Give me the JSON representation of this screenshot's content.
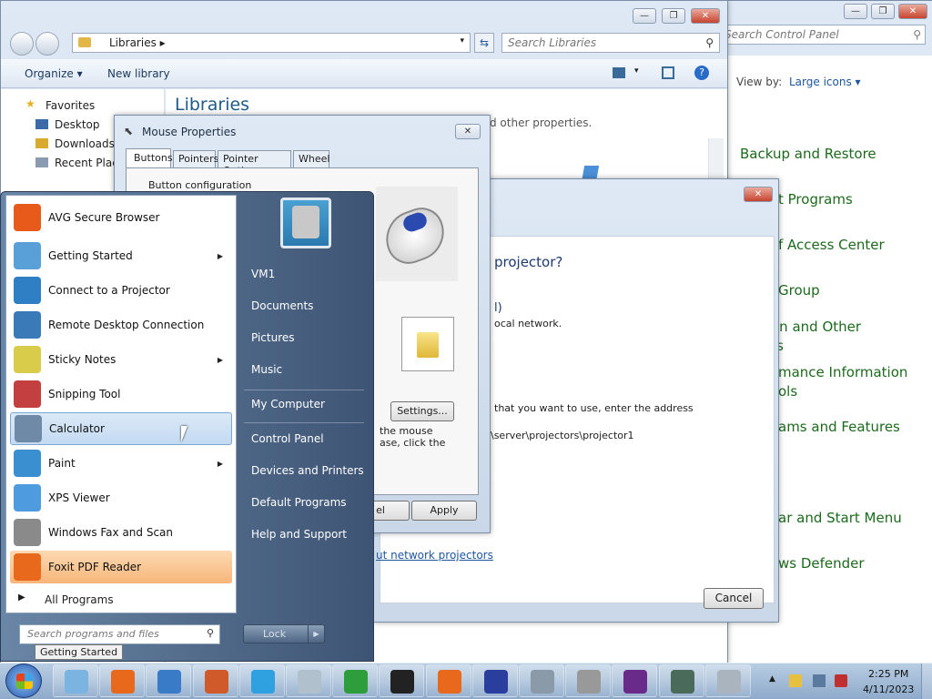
{
  "control_panel": {
    "search_placeholder": "Search Control Panel",
    "view_by_label": "View by:",
    "view_by_value": "Large icons",
    "items": [
      "Backup and Restore",
      "t Programs",
      "f Access Center",
      "Group",
      "on and Other",
      "rs",
      "mance Information",
      "ols",
      "ams and Features",
      "ar and Start Menu",
      "ws Defender"
    ]
  },
  "libraries": {
    "address": "Libraries",
    "search_placeholder": "Search Libraries",
    "organize": "Organize",
    "new_library": "New library",
    "title": "Libraries",
    "desc": "d other properties.",
    "nav": {
      "favorites": "Favorites",
      "desktop": "Desktop",
      "downloads": "Downloads",
      "recent": "Recent Place"
    }
  },
  "mouse": {
    "title": "Mouse Properties",
    "tabs": [
      "Buttons",
      "Pointers",
      "Pointer Options",
      "Wheel"
    ],
    "group": "Button configuration",
    "settings": "Settings...",
    "text1": "the mouse",
    "text2": "ase, click the",
    "cancel_partial": "el",
    "apply": "Apply"
  },
  "projector": {
    "question": "projector?",
    "line1": "l)",
    "line2": "ocal network.",
    "line3": "that you want to use, enter the address",
    "line4": "\\server\\projectors\\projector1",
    "link": "ut network projectors",
    "cancel": "Cancel"
  },
  "start_menu": {
    "items": [
      {
        "label": "AVG Secure Browser",
        "arrow": false,
        "color": "#e85a1a"
      },
      {
        "label": "Getting Started",
        "arrow": true,
        "color": "#5aa0d8"
      },
      {
        "label": "Connect to a Projector",
        "arrow": false,
        "color": "#2f7fc4"
      },
      {
        "label": "Remote Desktop Connection",
        "arrow": false,
        "color": "#3a7ab8"
      },
      {
        "label": "Sticky Notes",
        "arrow": true,
        "color": "#d8cc4a"
      },
      {
        "label": "Snipping Tool",
        "arrow": false,
        "color": "#c44040"
      },
      {
        "label": "Calculator",
        "arrow": false,
        "color": "#6f8aa6"
      },
      {
        "label": "Paint",
        "arrow": true,
        "color": "#3a8fd0"
      },
      {
        "label": "XPS Viewer",
        "arrow": false,
        "color": "#4e9be0"
      },
      {
        "label": "Windows Fax and Scan",
        "arrow": false,
        "color": "#8a8a8a"
      },
      {
        "label": "Foxit PDF Reader",
        "arrow": false,
        "color": "#e8691c"
      }
    ],
    "all_programs": "All Programs",
    "search_placeholder": "Search programs and files",
    "tooltip": "Getting Started",
    "right": [
      "VM1",
      "Documents",
      "Pictures",
      "Music",
      "My Computer",
      "Control Panel",
      "Devices and Printers",
      "Default Programs",
      "Help and Support"
    ],
    "lock": "Lock"
  },
  "taskbar": {
    "time": "2:25 PM",
    "date": "4/11/2023",
    "buttons": [
      "#7bb4e0",
      "#e8691c",
      "#3a7bc8",
      "#d05a2a",
      "#2fa0e0",
      "#b0c0cc",
      "#2e9e3c",
      "#222",
      "#e8691c",
      "#2a3e9e",
      "#8a9aa8",
      "#999",
      "#6a2a8a",
      "#4a6a5a",
      "#aab4be"
    ]
  }
}
